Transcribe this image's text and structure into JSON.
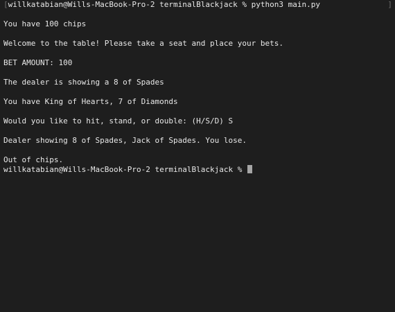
{
  "terminal": {
    "prompt": "willkatabian@Wills-MacBook-Pro-2 terminalBlackjack %",
    "command": "python3 main.py",
    "bracket_left": "[",
    "bracket_right": "]",
    "output": [
      "You have 100 chips",
      "Welcome to the table! Please take a seat and place your bets.",
      "BET AMOUNT: 100",
      "The dealer is showing a 8 of Spades",
      "You have King of Hearts, 7 of Diamonds",
      "Would you like to hit, stand, or double: (H/S/D) S",
      "Dealer showing 8 of Spades, Jack of Spades. You lose.",
      "Out of chips."
    ],
    "final_prompt": "willkatabian@Wills-MacBook-Pro-2 terminalBlackjack %"
  }
}
